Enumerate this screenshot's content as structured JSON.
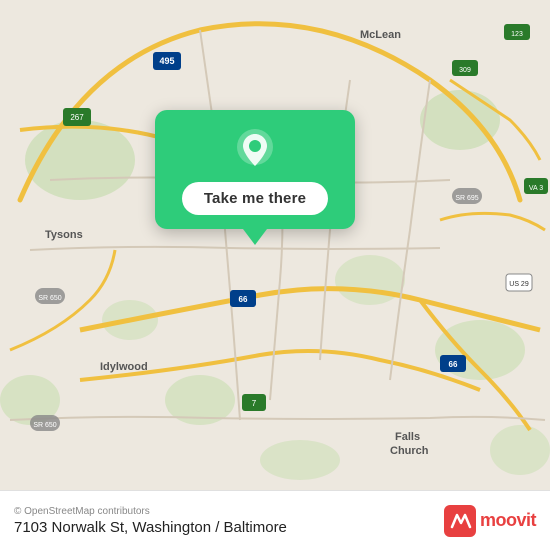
{
  "map": {
    "background_color": "#e8e0d8",
    "center": "7103 Norwalk St, Washington/Baltimore area"
  },
  "popup": {
    "button_label": "Take me there",
    "pin_color": "#ffffff"
  },
  "footer": {
    "attribution": "© OpenStreetMap contributors",
    "address": "7103 Norwalk St, Washington / Baltimore",
    "moovit_label": "moovit"
  }
}
